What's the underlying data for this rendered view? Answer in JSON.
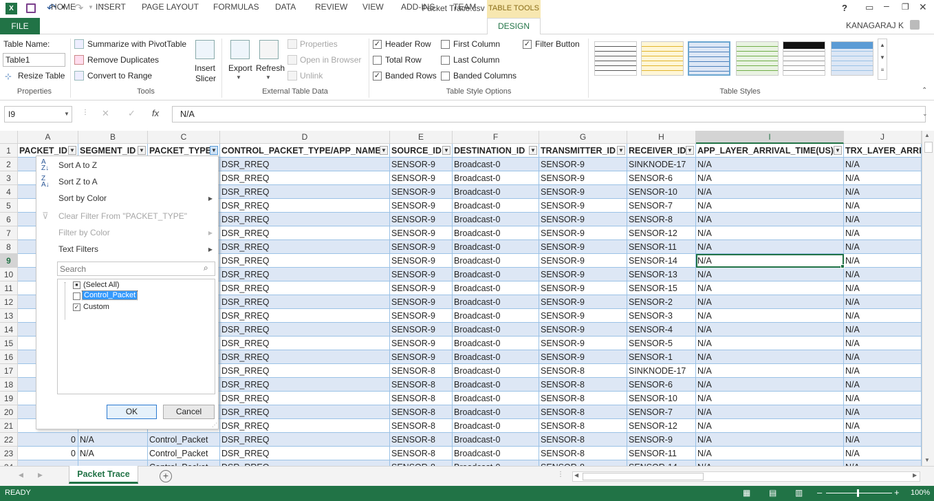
{
  "window": {
    "title": "Packet Trace.csv - Excel",
    "table_tools": "TABLE TOOLS",
    "user": "KANAGARAJ K"
  },
  "tabs": [
    "FILE",
    "HOME",
    "INSERT",
    "PAGE LAYOUT",
    "FORMULAS",
    "DATA",
    "REVIEW",
    "VIEW",
    "ADD-INS",
    "TEAM",
    "DESIGN"
  ],
  "ribbon": {
    "table_name_label": "Table Name:",
    "table_name_value": "Table1",
    "resize_table": "Resize Table",
    "properties_group": "Properties",
    "summarize_pivot": "Summarize with PivotTable",
    "remove_duplicates": "Remove Duplicates",
    "convert_to_range": "Convert to Range",
    "insert_slicer_1": "Insert",
    "insert_slicer_2": "Slicer",
    "tools_group": "Tools",
    "export": "Export",
    "refresh": "Refresh",
    "properties": "Properties",
    "open_in_browser": "Open in Browser",
    "unlink": "Unlink",
    "external_group": "External Table Data",
    "header_row": "Header Row",
    "total_row": "Total Row",
    "banded_rows": "Banded Rows",
    "first_column": "First Column",
    "last_column": "Last Column",
    "banded_columns": "Banded Columns",
    "filter_button": "Filter Button",
    "style_options_group": "Table Style Options",
    "styles_group": "Table Styles"
  },
  "formula_bar": {
    "name_box": "I9",
    "fx": "fx",
    "value": "N/A"
  },
  "columns": [
    {
      "letter": "A",
      "header": "PACKET_ID"
    },
    {
      "letter": "B",
      "header": "SEGMENT_ID"
    },
    {
      "letter": "C",
      "header": "PACKET_TYPE"
    },
    {
      "letter": "D",
      "header": "CONTROL_PACKET_TYPE/APP_NAME"
    },
    {
      "letter": "E",
      "header": "SOURCE_ID"
    },
    {
      "letter": "F",
      "header": "DESTINATION_ID"
    },
    {
      "letter": "G",
      "header": "TRANSMITTER_ID"
    },
    {
      "letter": "H",
      "header": "RECEIVER_ID"
    },
    {
      "letter": "I",
      "header": "APP_LAYER_ARRIVAL_TIME(US)"
    },
    {
      "letter": "J",
      "header": "TRX_LAYER_ARRIV"
    }
  ],
  "row_numbers": [
    "1",
    "2",
    "3",
    "4",
    "5",
    "6",
    "7",
    "8",
    "9",
    "10",
    "11",
    "12",
    "13",
    "14",
    "15",
    "16",
    "17",
    "18",
    "19",
    "20",
    "21",
    "22",
    "23",
    "24"
  ],
  "rows": [
    {
      "a": "",
      "b": "",
      "c": "",
      "d": "DSR_RREQ",
      "e": "SENSOR-9",
      "f": "Broadcast-0",
      "g": "SENSOR-9",
      "h": "SINKNODE-17",
      "i": "N/A",
      "j": "N/A"
    },
    {
      "a": "",
      "b": "",
      "c": "",
      "d": "DSR_RREQ",
      "e": "SENSOR-9",
      "f": "Broadcast-0",
      "g": "SENSOR-9",
      "h": "SENSOR-6",
      "i": "N/A",
      "j": "N/A"
    },
    {
      "a": "",
      "b": "",
      "c": "",
      "d": "DSR_RREQ",
      "e": "SENSOR-9",
      "f": "Broadcast-0",
      "g": "SENSOR-9",
      "h": "SENSOR-10",
      "i": "N/A",
      "j": "N/A"
    },
    {
      "a": "",
      "b": "",
      "c": "",
      "d": "DSR_RREQ",
      "e": "SENSOR-9",
      "f": "Broadcast-0",
      "g": "SENSOR-9",
      "h": "SENSOR-7",
      "i": "N/A",
      "j": "N/A"
    },
    {
      "a": "",
      "b": "",
      "c": "",
      "d": "DSR_RREQ",
      "e": "SENSOR-9",
      "f": "Broadcast-0",
      "g": "SENSOR-9",
      "h": "SENSOR-8",
      "i": "N/A",
      "j": "N/A"
    },
    {
      "a": "",
      "b": "",
      "c": "",
      "d": "DSR_RREQ",
      "e": "SENSOR-9",
      "f": "Broadcast-0",
      "g": "SENSOR-9",
      "h": "SENSOR-12",
      "i": "N/A",
      "j": "N/A"
    },
    {
      "a": "",
      "b": "",
      "c": "",
      "d": "DSR_RREQ",
      "e": "SENSOR-9",
      "f": "Broadcast-0",
      "g": "SENSOR-9",
      "h": "SENSOR-11",
      "i": "N/A",
      "j": "N/A"
    },
    {
      "a": "",
      "b": "",
      "c": "",
      "d": "DSR_RREQ",
      "e": "SENSOR-9",
      "f": "Broadcast-0",
      "g": "SENSOR-9",
      "h": "SENSOR-14",
      "i": "N/A",
      "j": "N/A"
    },
    {
      "a": "",
      "b": "",
      "c": "",
      "d": "DSR_RREQ",
      "e": "SENSOR-9",
      "f": "Broadcast-0",
      "g": "SENSOR-9",
      "h": "SENSOR-13",
      "i": "N/A",
      "j": "N/A"
    },
    {
      "a": "",
      "b": "",
      "c": "",
      "d": "DSR_RREQ",
      "e": "SENSOR-9",
      "f": "Broadcast-0",
      "g": "SENSOR-9",
      "h": "SENSOR-15",
      "i": "N/A",
      "j": "N/A"
    },
    {
      "a": "",
      "b": "",
      "c": "",
      "d": "DSR_RREQ",
      "e": "SENSOR-9",
      "f": "Broadcast-0",
      "g": "SENSOR-9",
      "h": "SENSOR-2",
      "i": "N/A",
      "j": "N/A"
    },
    {
      "a": "",
      "b": "",
      "c": "",
      "d": "DSR_RREQ",
      "e": "SENSOR-9",
      "f": "Broadcast-0",
      "g": "SENSOR-9",
      "h": "SENSOR-3",
      "i": "N/A",
      "j": "N/A"
    },
    {
      "a": "",
      "b": "",
      "c": "",
      "d": "DSR_RREQ",
      "e": "SENSOR-9",
      "f": "Broadcast-0",
      "g": "SENSOR-9",
      "h": "SENSOR-4",
      "i": "N/A",
      "j": "N/A"
    },
    {
      "a": "",
      "b": "",
      "c": "",
      "d": "DSR_RREQ",
      "e": "SENSOR-9",
      "f": "Broadcast-0",
      "g": "SENSOR-9",
      "h": "SENSOR-5",
      "i": "N/A",
      "j": "N/A"
    },
    {
      "a": "",
      "b": "",
      "c": "",
      "d": "DSR_RREQ",
      "e": "SENSOR-9",
      "f": "Broadcast-0",
      "g": "SENSOR-9",
      "h": "SENSOR-1",
      "i": "N/A",
      "j": "N/A"
    },
    {
      "a": "",
      "b": "",
      "c": "",
      "d": "DSR_RREQ",
      "e": "SENSOR-8",
      "f": "Broadcast-0",
      "g": "SENSOR-8",
      "h": "SINKNODE-17",
      "i": "N/A",
      "j": "N/A"
    },
    {
      "a": "",
      "b": "",
      "c": "",
      "d": "DSR_RREQ",
      "e": "SENSOR-8",
      "f": "Broadcast-0",
      "g": "SENSOR-8",
      "h": "SENSOR-6",
      "i": "N/A",
      "j": "N/A"
    },
    {
      "a": "",
      "b": "",
      "c": "",
      "d": "DSR_RREQ",
      "e": "SENSOR-8",
      "f": "Broadcast-0",
      "g": "SENSOR-8",
      "h": "SENSOR-10",
      "i": "N/A",
      "j": "N/A"
    },
    {
      "a": "",
      "b": "",
      "c": "",
      "d": "DSR_RREQ",
      "e": "SENSOR-8",
      "f": "Broadcast-0",
      "g": "SENSOR-8",
      "h": "SENSOR-7",
      "i": "N/A",
      "j": "N/A"
    },
    {
      "a": "",
      "b": "",
      "c": "",
      "d": "DSR_RREQ",
      "e": "SENSOR-8",
      "f": "Broadcast-0",
      "g": "SENSOR-8",
      "h": "SENSOR-12",
      "i": "N/A",
      "j": "N/A"
    },
    {
      "a": "0",
      "b": "N/A",
      "c": "Control_Packet",
      "d": "DSR_RREQ",
      "e": "SENSOR-8",
      "f": "Broadcast-0",
      "g": "SENSOR-8",
      "h": "SENSOR-9",
      "i": "N/A",
      "j": "N/A"
    },
    {
      "a": "0",
      "b": "N/A",
      "c": "Control_Packet",
      "d": "DSR_RREQ",
      "e": "SENSOR-8",
      "f": "Broadcast-0",
      "g": "SENSOR-8",
      "h": "SENSOR-11",
      "i": "N/A",
      "j": "N/A"
    },
    {
      "a": "",
      "b": "",
      "c": "Control_Packet",
      "d": "DSR_RREQ",
      "e": "SENSOR-8",
      "f": "Broadcast-0",
      "g": "SENSOR-8",
      "h": "SENSOR-14",
      "i": "N/A",
      "j": "N/A"
    }
  ],
  "filter_menu": {
    "sort_az": "Sort A to Z",
    "sort_za": "Sort Z to A",
    "sort_color": "Sort by Color",
    "clear_filter": "Clear Filter From \"PACKET_TYPE\"",
    "filter_color": "Filter by Color",
    "text_filters": "Text Filters",
    "search_placeholder": "Search",
    "items": [
      {
        "label": "(Select All)",
        "state": "partial"
      },
      {
        "label": "Control_Packet",
        "state": "unchecked"
      },
      {
        "label": "Custom",
        "state": "checked"
      }
    ],
    "ok": "OK",
    "cancel": "Cancel"
  },
  "sheet": {
    "tab": "Packet Trace"
  },
  "status": {
    "ready": "READY",
    "zoom": "100%"
  },
  "colors": {
    "excel_green": "#217346",
    "band": "#dde7f5",
    "table_border": "#9bc2e6"
  }
}
